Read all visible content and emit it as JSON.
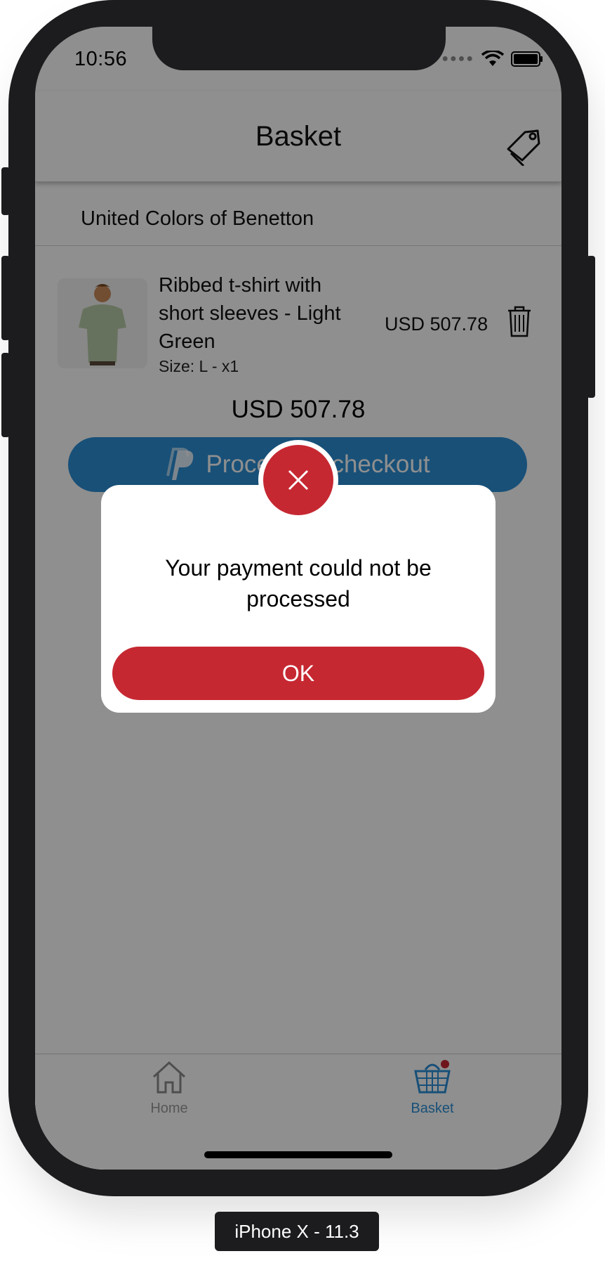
{
  "status_bar": {
    "time": "10:56"
  },
  "navbar": {
    "title": "Basket",
    "right_icon": "tag-icon"
  },
  "store": {
    "name": "United Colors of Benetton"
  },
  "item": {
    "name": "Ribbed t-shirt with short sleeves - Light Green",
    "size": "Size: L - x1",
    "price": "USD 507.78",
    "delete_icon": "trash-icon"
  },
  "total": "USD 507.78",
  "checkout": {
    "label": "Proceed to checkout",
    "icon": "paypal-icon",
    "color": "#2b8fd6"
  },
  "alert": {
    "icon": "close-icon",
    "message": "Your payment could not be processed",
    "button_label": "OK",
    "color": "#c62832"
  },
  "tabbar": {
    "tabs": [
      {
        "label": "Home",
        "icon": "home-icon",
        "active": false
      },
      {
        "label": "Basket",
        "icon": "basket-icon",
        "active": true,
        "badge": true
      }
    ]
  },
  "device_label": "iPhone X - 11.3"
}
